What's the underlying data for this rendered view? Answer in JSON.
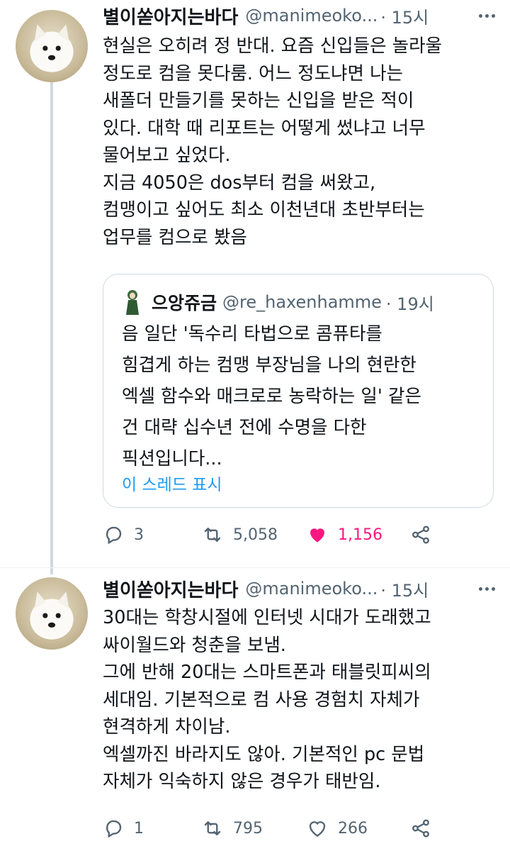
{
  "tweets": [
    {
      "name": "별이쏟아지는바다",
      "handle": "@manimeoko...",
      "time": "· 15시",
      "lines": [
        "현실은 오히려 정 반대. 요즘 신입들은 놀라울",
        "정도로 컴을 못다룸. 어느 정도냐면 나는",
        "새폴더 만들기를 못하는 신입을 받은 적이",
        "있다. 대학 때 리포트는 어떻게 썼냐고 너무",
        "물어보고 싶었다.",
        "지금 4050은 dos부터 컴을 써왔고,",
        "컴맹이고 싶어도 최소 이천년대 초반부터는",
        "업무를 컴으로 봤음"
      ],
      "quote": {
        "name": "으앙쥬금",
        "handle": "@re_haxenhamme",
        "time": "· 19시",
        "lines": [
          "음 일단 '독수리 타법으로 콤퓨타를",
          "힘겹게 하는 컴맹 부장님을 나의 현란한",
          "엑셀 함수와 매크로로 농락하는 일' 같은",
          "건 대략 십수년 전에 수명을 다한",
          "픽션입니다..."
        ],
        "show_thread": "이 스레드 표시"
      },
      "replies": "3",
      "retweets": "5,058",
      "likes": "1,156",
      "liked": true
    },
    {
      "name": "별이쏟아지는바다",
      "handle": "@manimeoko...",
      "time": "· 15시",
      "lines": [
        "30대는 학창시절에 인터넷 시대가 도래했고",
        "싸이월드와 청춘을 보냄.",
        "그에 반해 20대는 스마트폰과 태블릿피씨의",
        "세대임. 기본적으로 컴 사용 경험치 자체가",
        "현격하게 차이남.",
        "엑셀까진 바라지도 않아. 기본적인 pc 문법",
        "자체가 익숙하지 않은 경우가 태반임."
      ],
      "replies": "1",
      "retweets": "795",
      "likes": "266",
      "liked": false
    }
  ],
  "icons": {
    "reply": "reply-icon",
    "retweet": "retweet-icon",
    "like": "heart-icon",
    "share": "share-icon",
    "more": "more-icon",
    "avatar": "dog-avatar"
  },
  "colors": {
    "like_active": "#f91880",
    "link": "#1d9bf0",
    "secondary_text": "#536471"
  }
}
